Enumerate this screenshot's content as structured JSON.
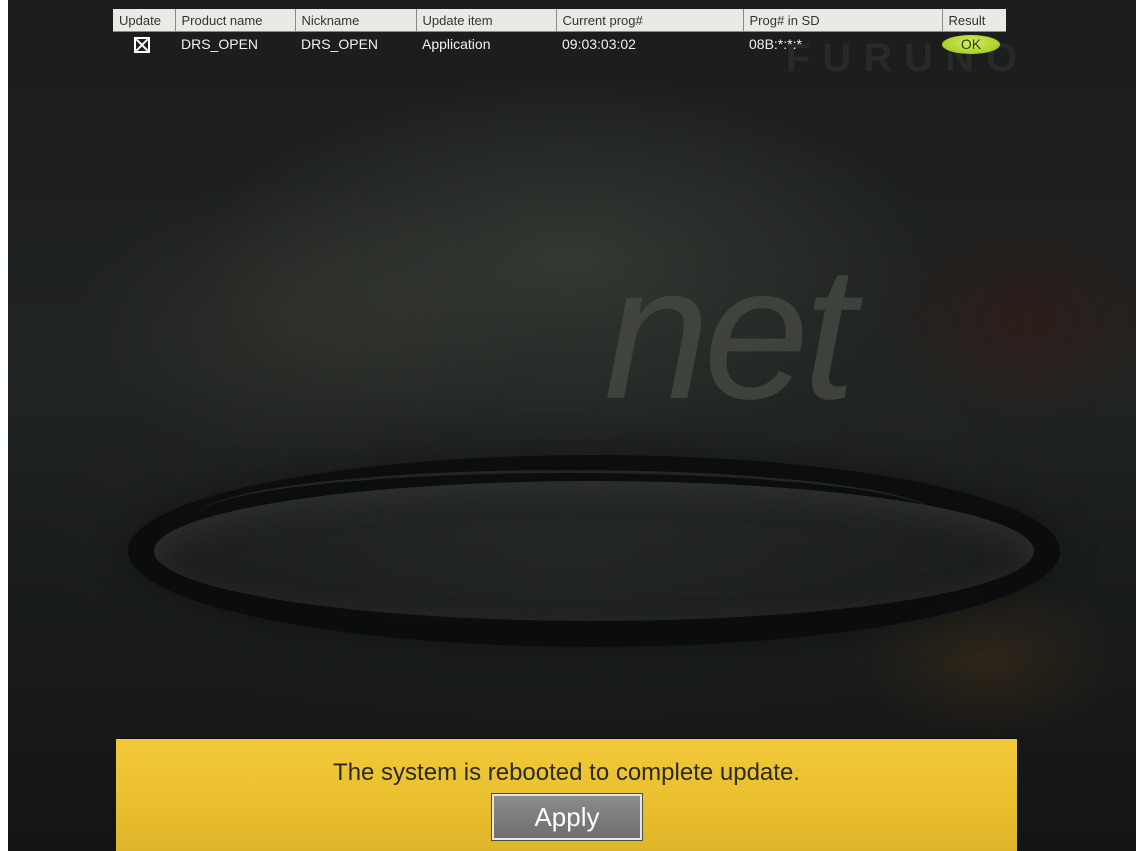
{
  "table": {
    "headers": [
      "Update",
      "Product name",
      "Nickname",
      "Update item",
      "Current prog#",
      "Prog# in SD",
      "Result"
    ],
    "rows": [
      {
        "update_checked": true,
        "product_name": "DRS_OPEN",
        "nickname": "DRS_OPEN",
        "update_item": "Application",
        "current_prog": "09:03:03:02",
        "prog_in_sd": "08B:*:*:*",
        "result": "OK"
      }
    ]
  },
  "background": {
    "brand_logo_text": "FURUNO",
    "watermark_word": "net"
  },
  "message_panel": {
    "text": "The system is rebooted to complete update.",
    "apply_label": "Apply"
  },
  "colors": {
    "panel_yellow": "#f2c93a",
    "result_ok_green": "#b6d93a",
    "header_grey": "#e9e9e6"
  }
}
